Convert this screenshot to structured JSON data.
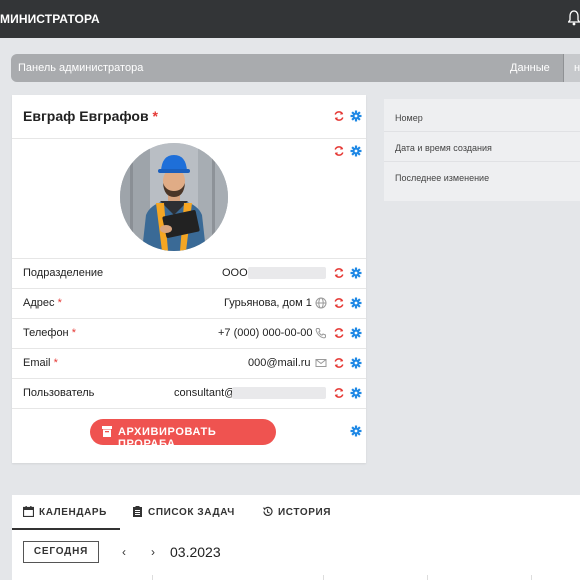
{
  "header": {
    "title": "МИНИСТРАТОРА"
  },
  "breadcrumb": {
    "left": "Панель администратора",
    "data": "Данные",
    "last": "на р"
  },
  "profile": {
    "name": "Евграф Евграфов",
    "required_mark": "*",
    "rows": [
      {
        "label": "Подразделение",
        "required": false,
        "value": "ООО"
      },
      {
        "label": "Адрес",
        "required": true,
        "value": "Гурьянова, дом 1"
      },
      {
        "label": "Телефон",
        "required": true,
        "value": "+7 (000) 000-00-00"
      },
      {
        "label": "Email",
        "required": true,
        "value": "000@mail.ru"
      },
      {
        "label": "Пользователь",
        "required": false,
        "value": "consultant@"
      }
    ],
    "archive_button": "АРХИВИРОВАТЬ ПРОРАБА"
  },
  "info_panel": {
    "fields": [
      "Номер",
      "Дата и время создания",
      "Последнее изменение"
    ]
  },
  "tabs": {
    "calendar": "КАЛЕНДАРЬ",
    "tasks": "СПИСОК ЗАДАЧ",
    "history": "ИСТОРИЯ"
  },
  "calendar": {
    "today_button": "СЕГОДНЯ",
    "prev": "‹",
    "next": "›",
    "month": "03.2023"
  },
  "colors": {
    "accent_blue": "#1e88e5",
    "refresh_red": "#e53935",
    "archive_red": "#ef5350"
  }
}
